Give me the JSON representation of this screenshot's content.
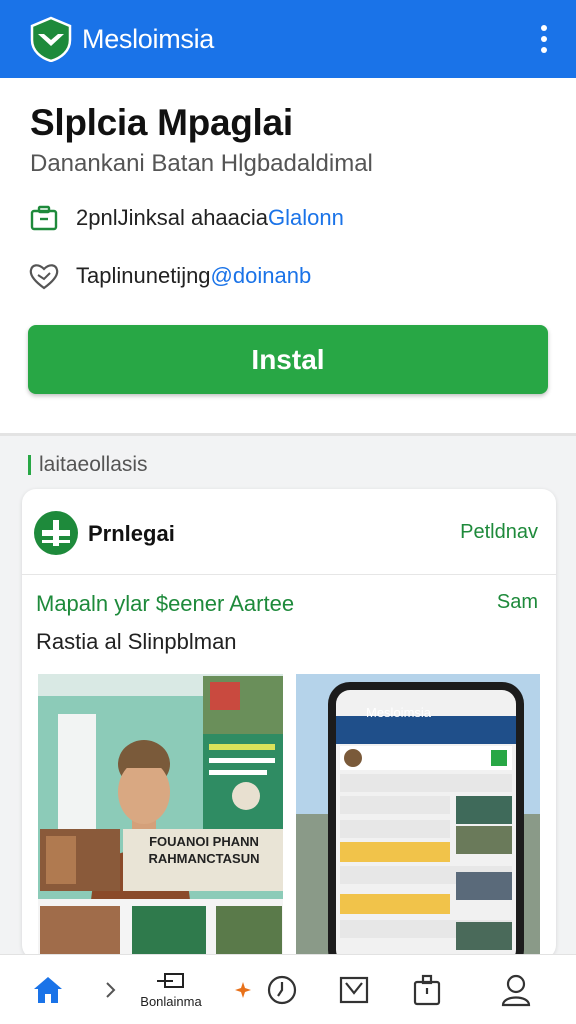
{
  "app_bar": {
    "title": "Mesloimsia",
    "logo_icon": "shield-logo-icon",
    "more_icon": "more-vert-icon",
    "color": "#1a73e8"
  },
  "header": {
    "app_name": "Slplcia Mpaglai",
    "subtitle": "Danankani Batan Hlgbadaldimal",
    "info_rows": [
      {
        "icon": "briefcase-icon",
        "text": "2pnlJinksal ahaacia",
        "accent": "Glalonn"
      },
      {
        "icon": "heart-icon",
        "text": "Taplinunetijng ",
        "accent": "@doinanb"
      }
    ],
    "install_label": "Instal",
    "install_color": "#28a745"
  },
  "section": {
    "title": "laitaeollasis",
    "card": {
      "name": "Prnlegai",
      "action": "Petldnav",
      "line1": "Mapaln ylar $eener Aartee",
      "line1_right": "Sam",
      "line2": "Rastia al Slinpblman",
      "left_shot": {
        "poster_text": "FOUANOI PHANN RAHMANCTASUN"
      },
      "right_shot": {
        "phone_title": "Mesloimsia"
      }
    }
  },
  "bottom_nav": {
    "items": [
      {
        "icon": "home-icon",
        "label": ""
      },
      {
        "icon": "chevron-right-icon",
        "label": ""
      },
      {
        "icon": "message-icon",
        "label": "Bonlainma"
      },
      {
        "icon": "sparkle-icon",
        "label": ""
      },
      {
        "icon": "clock-icon",
        "label": ""
      },
      {
        "icon": "inbox-icon",
        "label": ""
      },
      {
        "icon": "bag-icon",
        "label": ""
      },
      {
        "icon": "person-icon",
        "label": ""
      }
    ]
  }
}
